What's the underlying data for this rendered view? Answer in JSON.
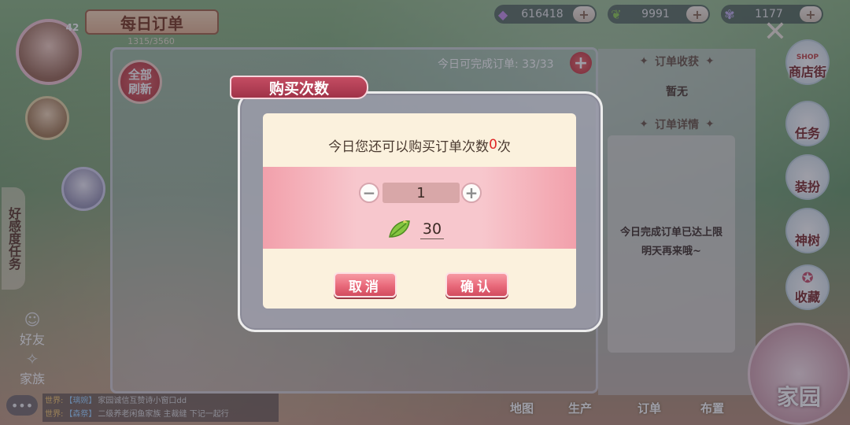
{
  "header": {
    "title": "每日订单",
    "player_id": "1315/3560",
    "level": "42"
  },
  "currencies": [
    {
      "icon": "gem-icon",
      "value": "616418"
    },
    {
      "icon": "leaf-icon",
      "value": "9991"
    },
    {
      "icon": "butterfly-icon",
      "value": "1177"
    }
  ],
  "orders": {
    "refresh_line1": "全部",
    "refresh_line2": "刷新",
    "completable": "今日可完成订单: 33/33"
  },
  "side_panel": {
    "order_rewards": "订单收获",
    "none": "暂无",
    "order_details": "订单详情",
    "limit_line1": "今日完成订单已达上限",
    "limit_line2": "明天再来哦~"
  },
  "right_nav": {
    "shop_tag": "SHOP",
    "items": [
      "商店街",
      "任务",
      "装扮",
      "神树",
      "收藏"
    ]
  },
  "left_nav": {
    "favor": "好感度任务",
    "friends": "好友",
    "family": "家族"
  },
  "chat": [
    {
      "tag": "世界:",
      "who": "【璃婉】",
      "text": "家园诚信互赞诗小窗口dd"
    },
    {
      "tag": "世界:",
      "who": "【森祭】",
      "text": "二级养老闲鱼家族 主裁缝 下记一起行"
    }
  ],
  "bottom_nav": [
    "地图",
    "生产",
    "订单",
    "布置"
  ],
  "home_label": "家园",
  "modal": {
    "title": "购买次数",
    "prompt_prefix": "今日您还可以购买订单次数",
    "prompt_count": "0",
    "prompt_suffix": "次",
    "minus": "−",
    "plus": "+",
    "quantity": "1",
    "cost": "30",
    "cancel": "取消",
    "confirm": "确认"
  },
  "colors": {
    "accent_red": "#e02626",
    "button_pink": "#e8697a",
    "panel_cream": "#fbf1dd"
  }
}
